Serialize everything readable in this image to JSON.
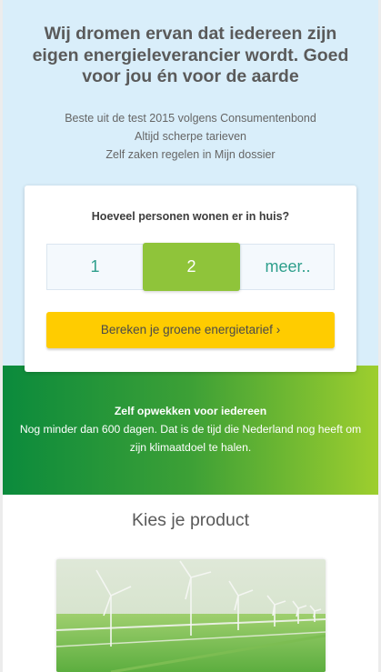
{
  "hero": {
    "headline_lines": [
      "Wij dromen ervan dat iedereen zijn",
      "eigen energieleverancier wordt. Goed",
      "voor jou én voor de aarde"
    ],
    "usps": [
      "Beste uit de test 2015 volgens Consumentenbond",
      "Altijd scherpe tarieven",
      "Zelf zaken regelen in Mijn dossier"
    ]
  },
  "calculator": {
    "question": "Hoeveel personen wonen er in huis?",
    "options": [
      "1",
      "2",
      "meer.."
    ],
    "selected_option": "2",
    "cta_label": "Bereken je groene energietarief ›"
  },
  "banner": {
    "title": "Zelf opwekken voor iedereen",
    "body_line1": "Nog minder dan 600 dagen. Dat is de tijd die Nederland nog heeft om",
    "body_line2": "zijn klimaatdoel te halen."
  },
  "products": {
    "title": "Kies je product",
    "image_icon": "wind-turbines-image"
  },
  "colors": {
    "hero_bg": "#d9eefa",
    "selected_green": "#8fc43a",
    "cta_yellow": "#ffcc00",
    "banner_start": "#0a8a3c",
    "banner_end": "#9fcf2e",
    "option_teal": "#2e9f8c"
  }
}
